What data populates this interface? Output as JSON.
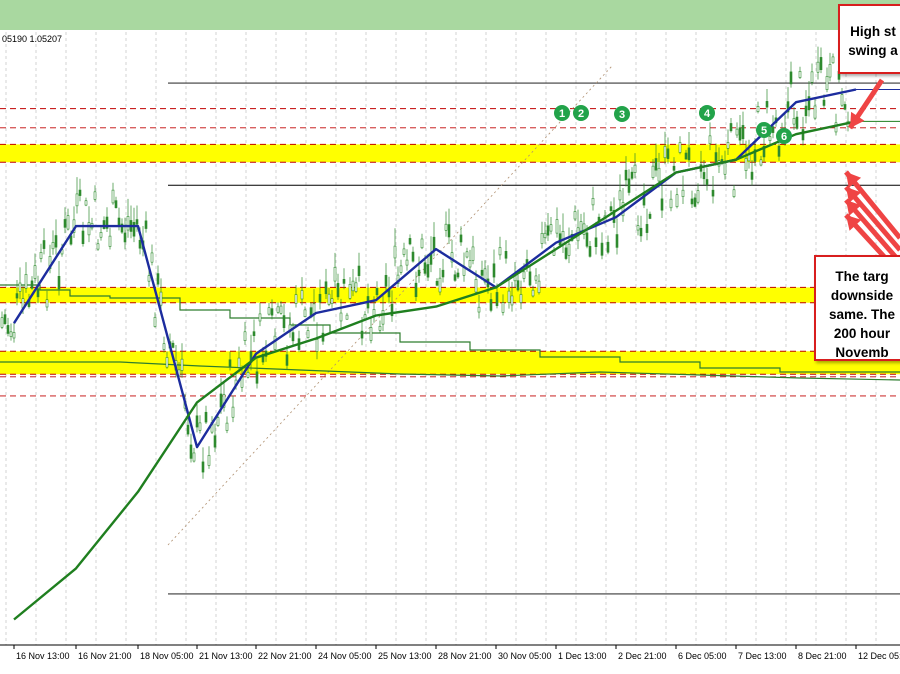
{
  "header": {
    "price_readout": "05190 1.05207"
  },
  "callouts": {
    "top": [
      "High st",
      "swing a"
    ],
    "middle": [
      "The targ",
      "downside",
      "same. The",
      "200 hour",
      "Novemb"
    ]
  },
  "colors": {
    "background": "#ffffff",
    "frame": "#a9d8a0",
    "grid": "#c9c9c9",
    "ma100": "#1c2c9e",
    "ma200": "#1f7f1f",
    "old_ma": "#2e7d2e",
    "zone": "#ffff00",
    "zone_line": "#c00000",
    "level_line": "#000000",
    "candle": "#2e8b2e",
    "marker": "#22a34a",
    "callout_border": "#d81e1e",
    "arrow": "#ef4444"
  },
  "chart_data": {
    "type": "line",
    "x": [
      "16 Nov 13:00",
      "16 Nov 21:00",
      "18 Nov 05:00",
      "21 Nov 13:00",
      "22 Nov 21:00",
      "24 Nov 05:00",
      "25 Nov 13:00",
      "28 Nov 21:00",
      "30 Nov 05:00",
      "1 Dec 13:00",
      "2 Dec 21:00",
      "6 Dec 05:00",
      "7 Dec 13:00",
      "8 Dec 21:00",
      "12 Dec 05:00"
    ],
    "ylim": [
      1.014,
      1.062
    ],
    "series": [
      {
        "values": [
          1.0392,
          1.0468,
          1.0468,
          1.0295,
          1.0368,
          1.04,
          1.041,
          1.045,
          1.042,
          1.0455,
          1.0475,
          1.051,
          1.052,
          1.0565,
          1.0575
        ]
      },
      {
        "values": [
          1.016,
          1.02,
          1.026,
          1.033,
          1.0365,
          1.038,
          1.0398,
          1.0405,
          1.042,
          1.045,
          1.048,
          1.051,
          1.052,
          1.054,
          1.055
        ]
      }
    ],
    "horizontal_lines": [
      1.058,
      1.056,
      1.0545,
      1.05,
      1.035,
      1.0335,
      1.018
    ],
    "yellow_zones": [
      [
        1.0532,
        1.0518
      ],
      [
        1.042,
        1.0408
      ],
      [
        1.037,
        1.0352
      ]
    ],
    "numbered_markers": [
      "1",
      "2",
      "3",
      "4",
      "5",
      "6"
    ],
    "grid": true
  }
}
